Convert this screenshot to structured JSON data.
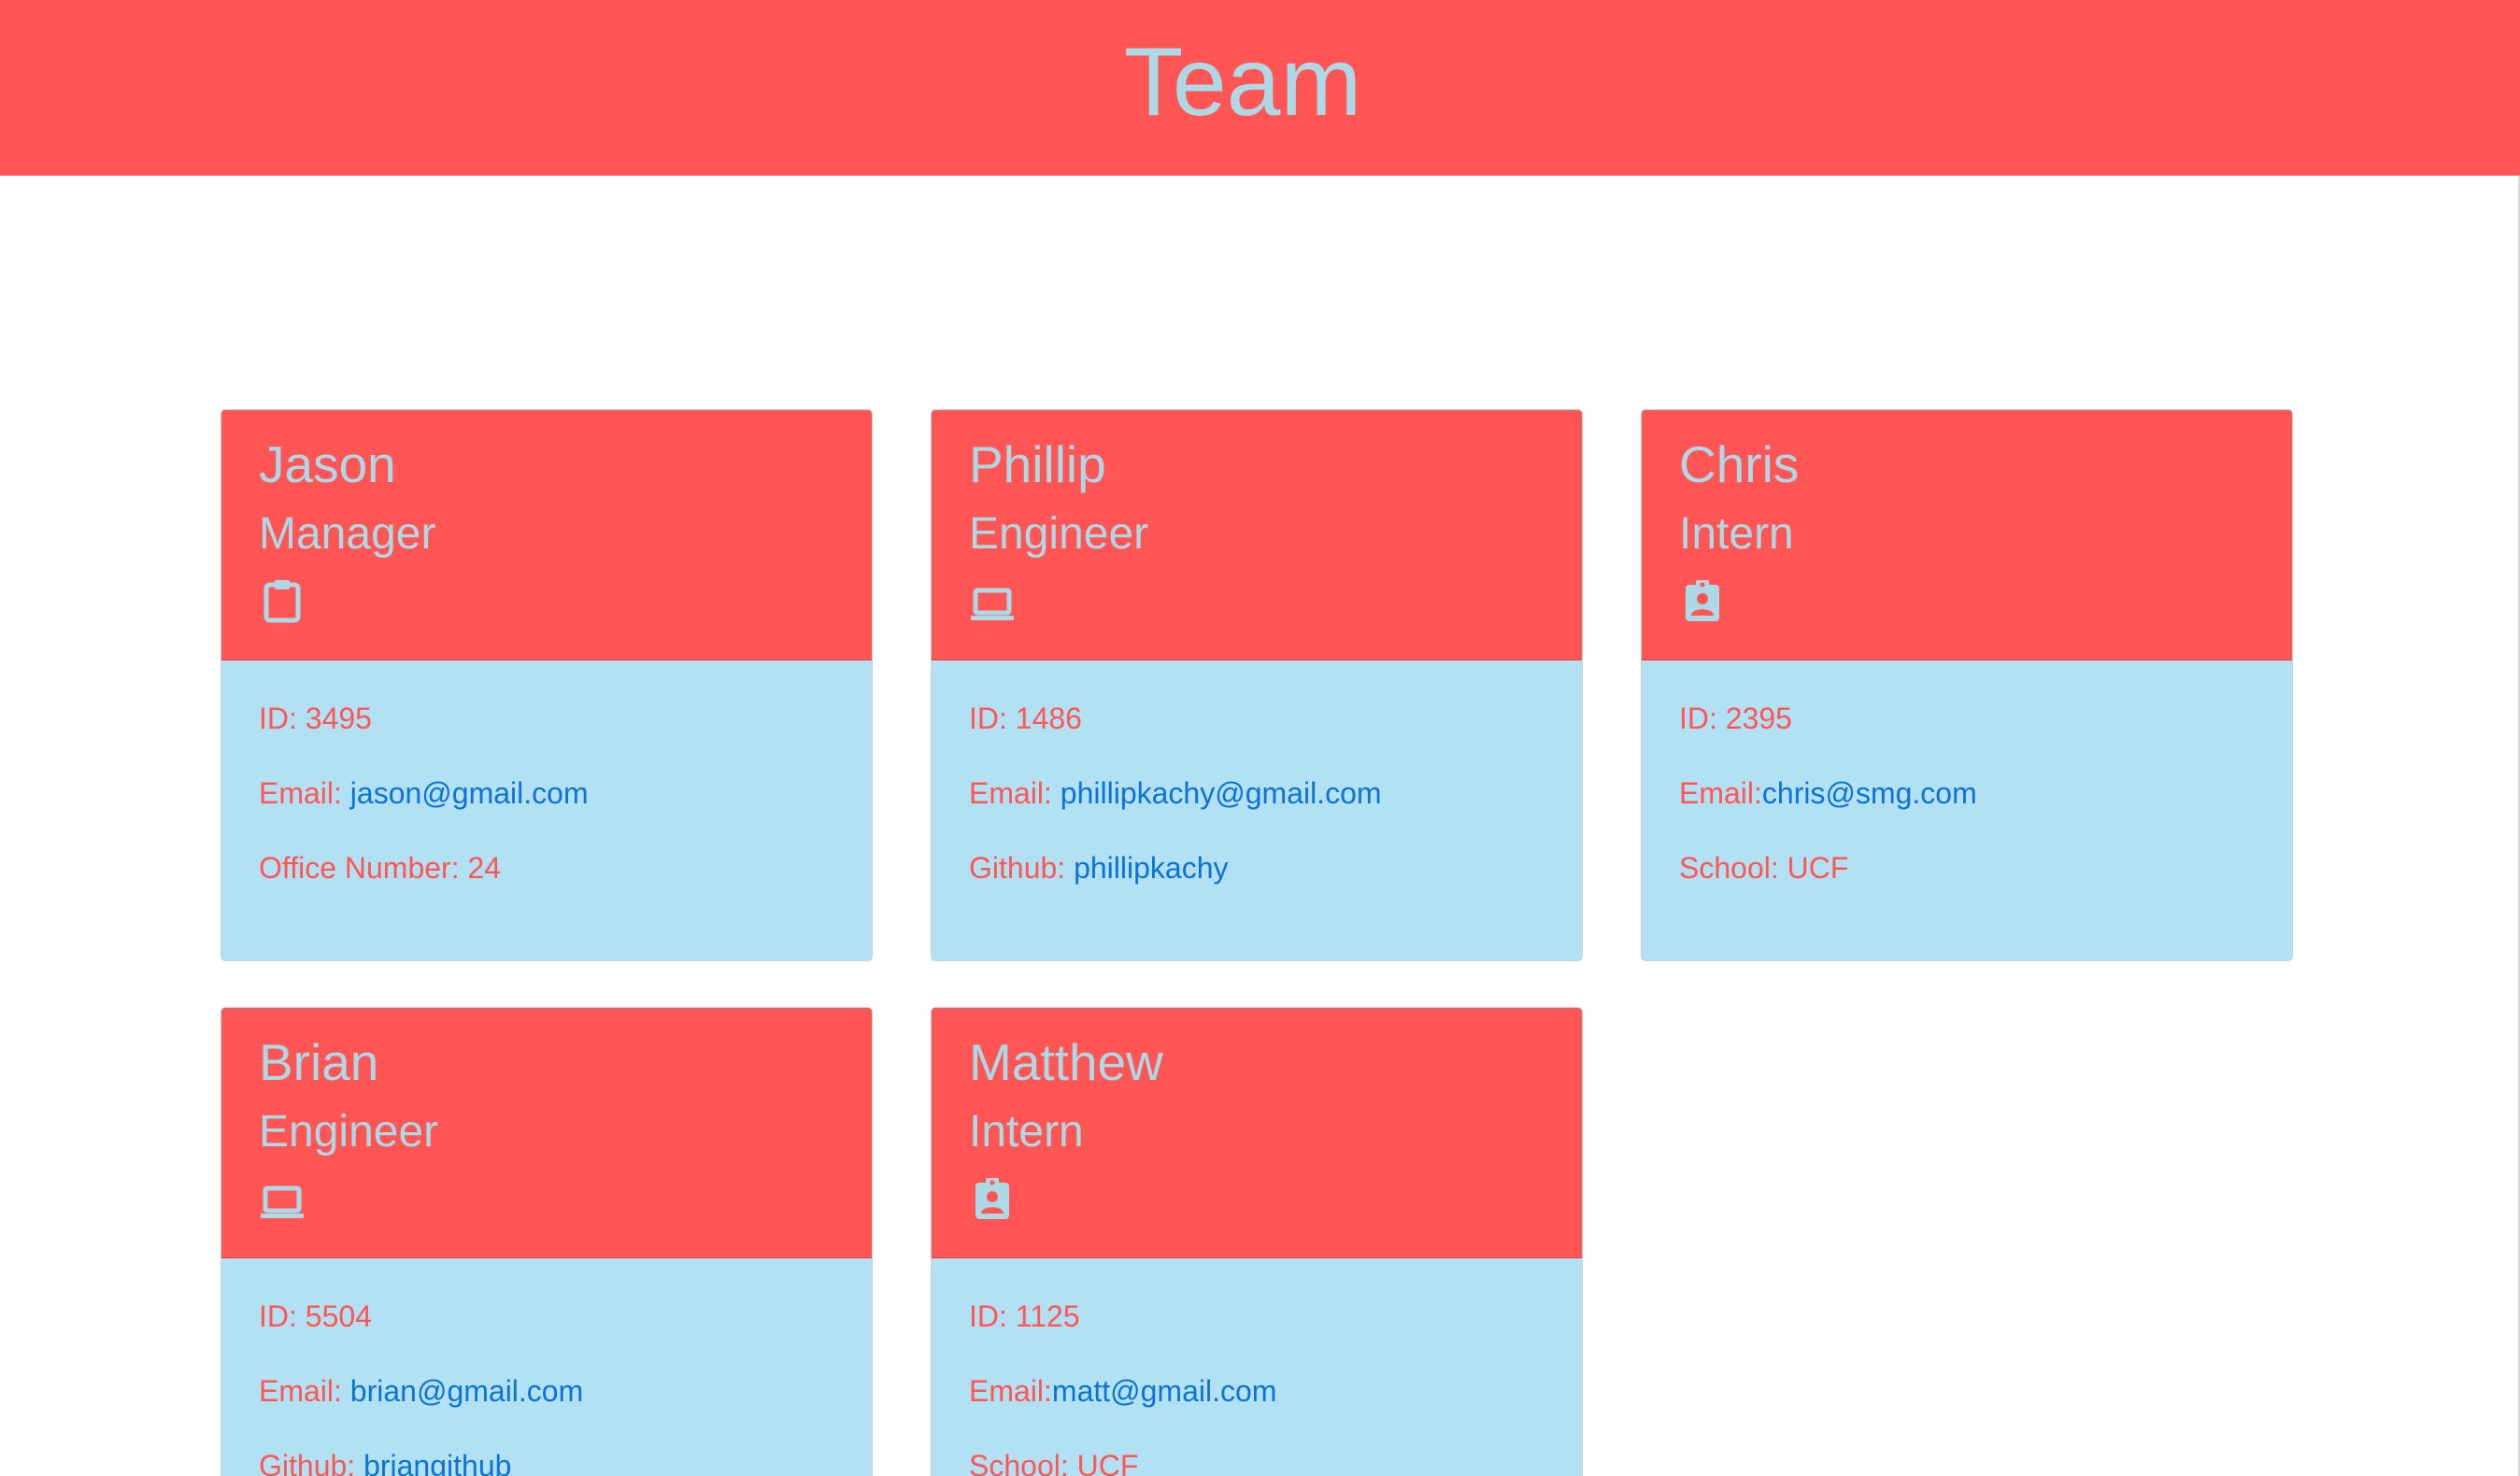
{
  "header": {
    "title": "Team"
  },
  "colors": {
    "header_background": "#ff5555",
    "card_header_background": "#ff5555",
    "card_body_background": "#b1e1f2",
    "title_text": "#add8e6",
    "label_text": "#ff5555",
    "link_text": "#0d72d9"
  },
  "cards": [
    {
      "name": "Jason",
      "role": "Manager",
      "icon": "clipboard-icon",
      "id_label": "ID: 3495",
      "email_label": "Email: ",
      "email": "jason@gmail.com",
      "extra_label": "Office Number: 24",
      "extra_value": ""
    },
    {
      "name": "Phillip",
      "role": "Engineer",
      "icon": "laptop-icon",
      "id_label": "ID: 1486",
      "email_label": "Email: ",
      "email": "phillipkachy@gmail.com",
      "extra_label": "Github: ",
      "extra_value": "phillipkachy"
    },
    {
      "name": "Chris",
      "role": "Intern",
      "icon": "assignment-ind-icon",
      "id_label": "ID: 2395",
      "email_label": "Email:",
      "email": "chris@smg.com",
      "extra_label": "School: UCF",
      "extra_value": ""
    },
    {
      "name": "Brian",
      "role": "Engineer",
      "icon": "laptop-icon",
      "id_label": "ID: 5504",
      "email_label": "Email: ",
      "email": "brian@gmail.com",
      "extra_label": "Github: ",
      "extra_value": "briangithub"
    },
    {
      "name": "Matthew",
      "role": "Intern",
      "icon": "assignment-ind-icon",
      "id_label": "ID: 1125",
      "email_label": "Email:",
      "email": "matt@gmail.com",
      "extra_label": "School: UCF",
      "extra_value": ""
    }
  ]
}
